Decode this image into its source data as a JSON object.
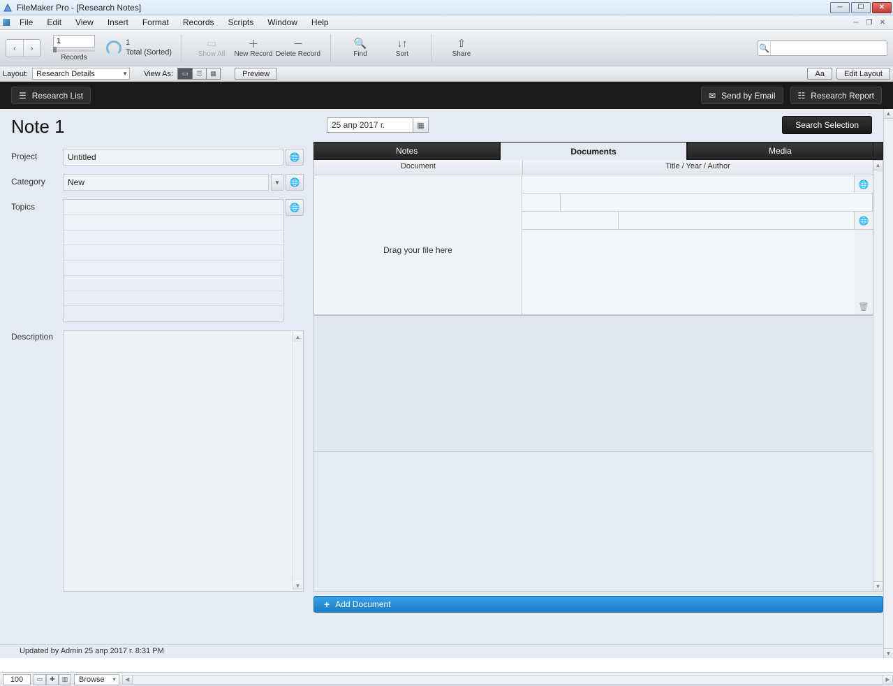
{
  "app": {
    "title": "FileMaker Pro - [Research Notes]"
  },
  "menus": [
    "File",
    "Edit",
    "View",
    "Insert",
    "Format",
    "Records",
    "Scripts",
    "Window",
    "Help"
  ],
  "toolbar": {
    "record_number": "1",
    "records_label": "Records",
    "status_count": "1",
    "status_text": "Total (Sorted)",
    "show_all": "Show All",
    "new_record": "New Record",
    "delete_record": "Delete Record",
    "find": "Find",
    "sort": "Sort",
    "share": "Share",
    "search_placeholder": ""
  },
  "layoutbar": {
    "layout_label": "Layout:",
    "layout_value": "Research Details",
    "view_as_label": "View As:",
    "preview": "Preview",
    "aa": "Aa",
    "edit_layout": "Edit Layout"
  },
  "blackbar": {
    "research_list": "Research List",
    "send_email": "Send by Email",
    "research_report": "Research Report"
  },
  "content": {
    "title": "Note 1",
    "date": "25 апр 2017 г.",
    "search_selection": "Search Selection",
    "left": {
      "project_label": "Project",
      "project_value": "Untitled",
      "category_label": "Category",
      "category_value": "New",
      "topics_label": "Topics",
      "description_label": "Description"
    },
    "tabs": {
      "notes": "Notes",
      "documents": "Documents",
      "media": "Media"
    },
    "doc_panel": {
      "col_document": "Document",
      "col_meta": "Title / Year / Author",
      "drop_hint": "Drag your file here",
      "add_document": "Add Document"
    },
    "updated_by": "Updated by Admin 25 апр 2017 г. 8:31 PM"
  },
  "statusbar": {
    "zoom": "100",
    "mode": "Browse"
  }
}
